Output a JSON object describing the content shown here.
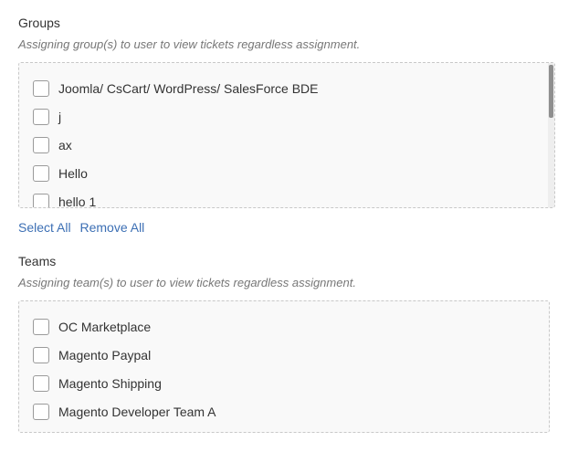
{
  "groups": {
    "title": "Groups",
    "help": "Assigning group(s) to user to view tickets regardless assignment.",
    "options": [
      {
        "label": "Joomla/ CsCart/ WordPress/ SalesForce BDE",
        "checked": false
      },
      {
        "label": "j",
        "checked": false
      },
      {
        "label": "ax",
        "checked": false
      },
      {
        "label": "Hello",
        "checked": false
      },
      {
        "label": "hello 1",
        "checked": false
      }
    ],
    "select_all_label": "Select All",
    "remove_all_label": "Remove All"
  },
  "teams": {
    "title": "Teams",
    "help": "Assigning team(s) to user to view tickets regardless assignment.",
    "options": [
      {
        "label": "OC Marketplace",
        "checked": false
      },
      {
        "label": "Magento Paypal",
        "checked": false
      },
      {
        "label": "Magento Shipping",
        "checked": false
      },
      {
        "label": "Magento Developer Team A",
        "checked": false
      }
    ]
  },
  "colors": {
    "link": "#3c6fb4",
    "box_background": "#f9f9f9",
    "box_border": "#c8c8c8"
  }
}
